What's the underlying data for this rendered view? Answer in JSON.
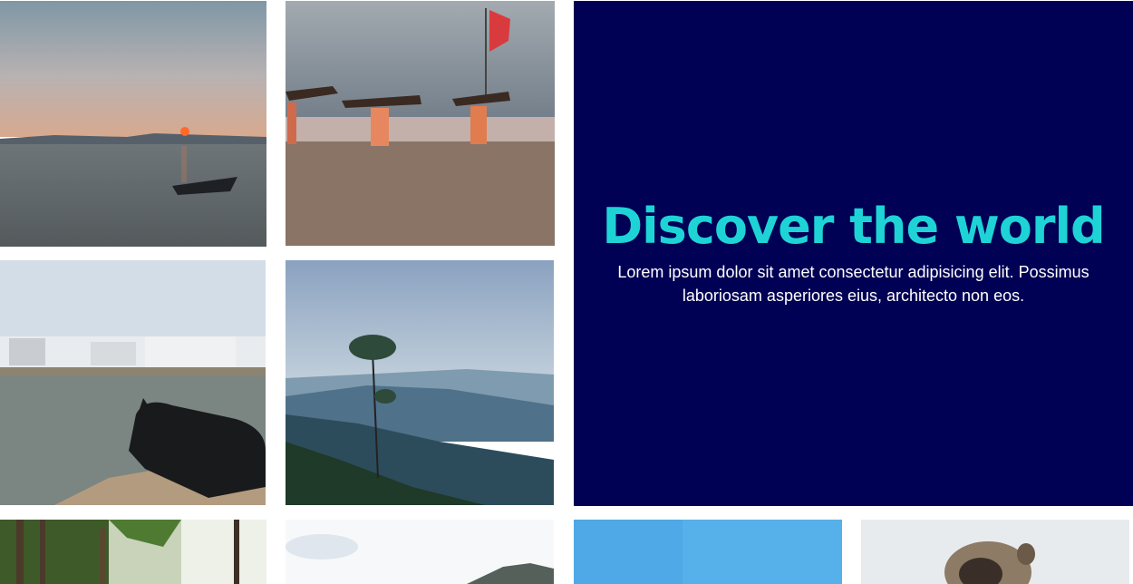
{
  "hero": {
    "title": "Discover the world",
    "text": "Lorem ipsum dolor sit amet consectetur adipisicing elit. Possimus laboriosam asperiores eius, architecto non eos."
  },
  "colors": {
    "hero_background": "#000055",
    "hero_title": "#1ed3d6",
    "hero_text": "#ffffff"
  },
  "gallery": {
    "photos": [
      {
        "subject": "sunset-lake-boat"
      },
      {
        "subject": "beach-people-carrying-wood"
      },
      {
        "subject": "lake-town-cow"
      },
      {
        "subject": "misty-hills-tree"
      },
      {
        "subject": "palm-trees"
      },
      {
        "subject": "cloudy-sky-hill"
      },
      {
        "subject": "blue-wall"
      },
      {
        "subject": "monkey"
      }
    ]
  }
}
